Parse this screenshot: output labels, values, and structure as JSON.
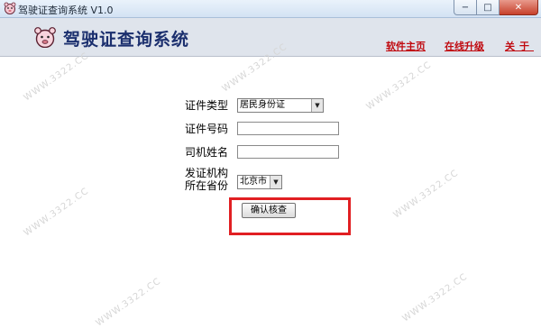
{
  "window": {
    "title": "驾驶证查询系统 V1.0",
    "controls": {
      "minimize": "−",
      "maximize": "□",
      "close": "✕"
    }
  },
  "banner": {
    "app_title": "驾驶证查询系统",
    "nav": {
      "home": "软件主页",
      "upgrade": "在线升级",
      "about": "关于"
    }
  },
  "form": {
    "cert_type": {
      "label": "证件类型",
      "value": "居民身份证"
    },
    "cert_number": {
      "label": "证件号码",
      "value": ""
    },
    "driver_name": {
      "label": "司机姓名",
      "value": ""
    },
    "issuing_province": {
      "label_line1": "发证机构",
      "label_line2": "所在省份",
      "value": "北京市"
    },
    "submit_label": "确认核查"
  },
  "watermark": "WWW.3322.CC",
  "colors": {
    "accent_red": "#e11f22",
    "nav_link": "#c0090f",
    "title_blue": "#1b2f6e",
    "banner_bg": "#dfe4ec"
  }
}
